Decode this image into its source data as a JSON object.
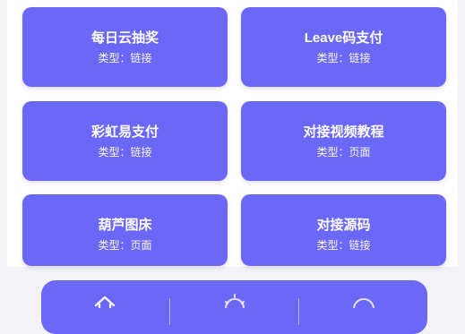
{
  "cards": [
    {
      "title": "每日云抽奖",
      "type": "类型：链接"
    },
    {
      "title": "Leave码支付",
      "type": "类型：链接"
    },
    {
      "title": "彩虹易支付",
      "type": "类型：链接"
    },
    {
      "title": "对接视频教程",
      "type": "类型：页面"
    },
    {
      "title": "葫芦图床",
      "type": "类型：页面"
    },
    {
      "title": "对接源码",
      "type": "类型：链接"
    }
  ],
  "tabbar": {
    "tabs": [
      {
        "icon": "home-icon"
      },
      {
        "icon": "settings-icon"
      },
      {
        "icon": "user-icon"
      }
    ]
  },
  "colors": {
    "accent": "#6c68f7",
    "background": "#f3f2f7"
  }
}
